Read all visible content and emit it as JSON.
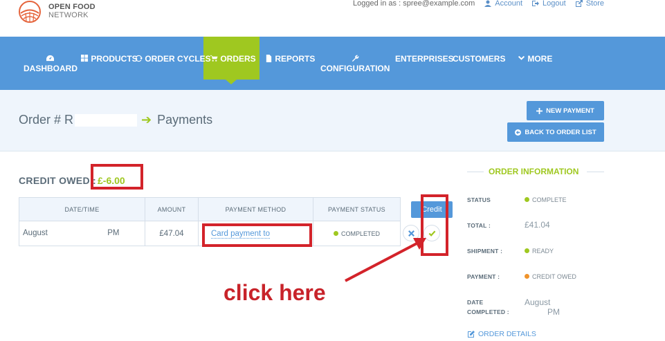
{
  "brand": {
    "line1": "OPEN FOOD",
    "line2": "NETWORK"
  },
  "header": {
    "logged_in": "Logged in as : spree@example.com",
    "account": "Account",
    "logout": "Logout",
    "store": "Store"
  },
  "nav": {
    "dashboard": "DASHBOARD",
    "products": "PRODUCTS",
    "order_cycles": "ORDER CYCLES",
    "orders": "ORDERS",
    "reports": "REPORTS",
    "configuration": "CONFIGURATION",
    "enterprises": "ENTERPRISES",
    "customers": "CUSTOMERS",
    "more": "MORE"
  },
  "page": {
    "title_prefix": "Order # R",
    "title_section": "Payments",
    "new_payment": "NEW PAYMENT",
    "back_to_list": "BACK TO ORDER LIST"
  },
  "credit": {
    "label": "CREDIT OWED :",
    "amount": "£-6.00"
  },
  "table": {
    "headers": [
      "DATE/TIME",
      "AMOUNT",
      "PAYMENT METHOD",
      "PAYMENT STATUS"
    ],
    "row": {
      "date_prefix": "August",
      "date_suffix": "PM",
      "amount": "£47.04",
      "method": "Card payment to",
      "status": "COMPLETED"
    },
    "credit_button": "Credit"
  },
  "annotation": {
    "click_here": "click here"
  },
  "order_info": {
    "title": "ORDER INFORMATION",
    "status_label": "STATUS",
    "status_value": "COMPLETE",
    "total_label": "TOTAL :",
    "total_value": "£41.04",
    "shipment_label": "SHIPMENT :",
    "shipment_value": "READY",
    "payment_label": "PAYMENT :",
    "payment_value": "CREDIT OWED",
    "date_label_1": "DATE",
    "date_label_2": "COMPLETED :",
    "date_value_1": "August",
    "date_value_2": "PM",
    "details_link": "ORDER DETAILS"
  },
  "colors": {
    "nav_blue": "#5498da",
    "accent_green": "#9fc820",
    "status_orange": "#f0932b",
    "annotation_red": "#d3232a"
  }
}
